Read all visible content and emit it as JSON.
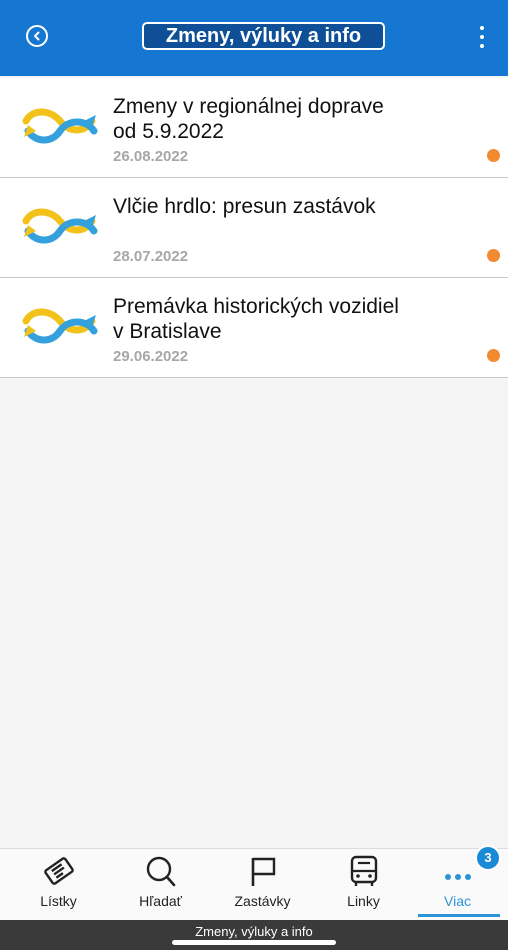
{
  "header": {
    "title": "Zmeny, výluky a info",
    "back_icon": "back-circle-icon",
    "menu_icon": "more-vertical-icon"
  },
  "news": [
    {
      "title_line1": "Zmeny v regionálnej doprave",
      "title_line2": "od 5.9.2022",
      "date": "26.08.2022"
    },
    {
      "title_line1": "Vlčie hrdlo: presun zastávok",
      "title_line2": "",
      "date": "28.07.2022"
    },
    {
      "title_line1": "Premávka historických vozidiel",
      "title_line2": "v Bratislave",
      "date": "29.06.2022"
    }
  ],
  "bottom_nav": {
    "items": [
      {
        "label": "Lístky",
        "icon": "ticket-icon"
      },
      {
        "label": "Hľadať",
        "icon": "search-icon"
      },
      {
        "label": "Zastávky",
        "icon": "flag-icon"
      },
      {
        "label": "Linky",
        "icon": "bus-icon"
      },
      {
        "label": "Viac",
        "icon": "more-horizontal-icon"
      }
    ],
    "badge": "3"
  },
  "tab_strip": {
    "label": "Zmeny, výluky a info"
  },
  "colors": {
    "header_bg": "#1677d2",
    "accent": "#2c94d6",
    "unread_dot": "#f28a30",
    "logo_yellow": "#f2c21b",
    "logo_blue": "#34a0dc"
  }
}
